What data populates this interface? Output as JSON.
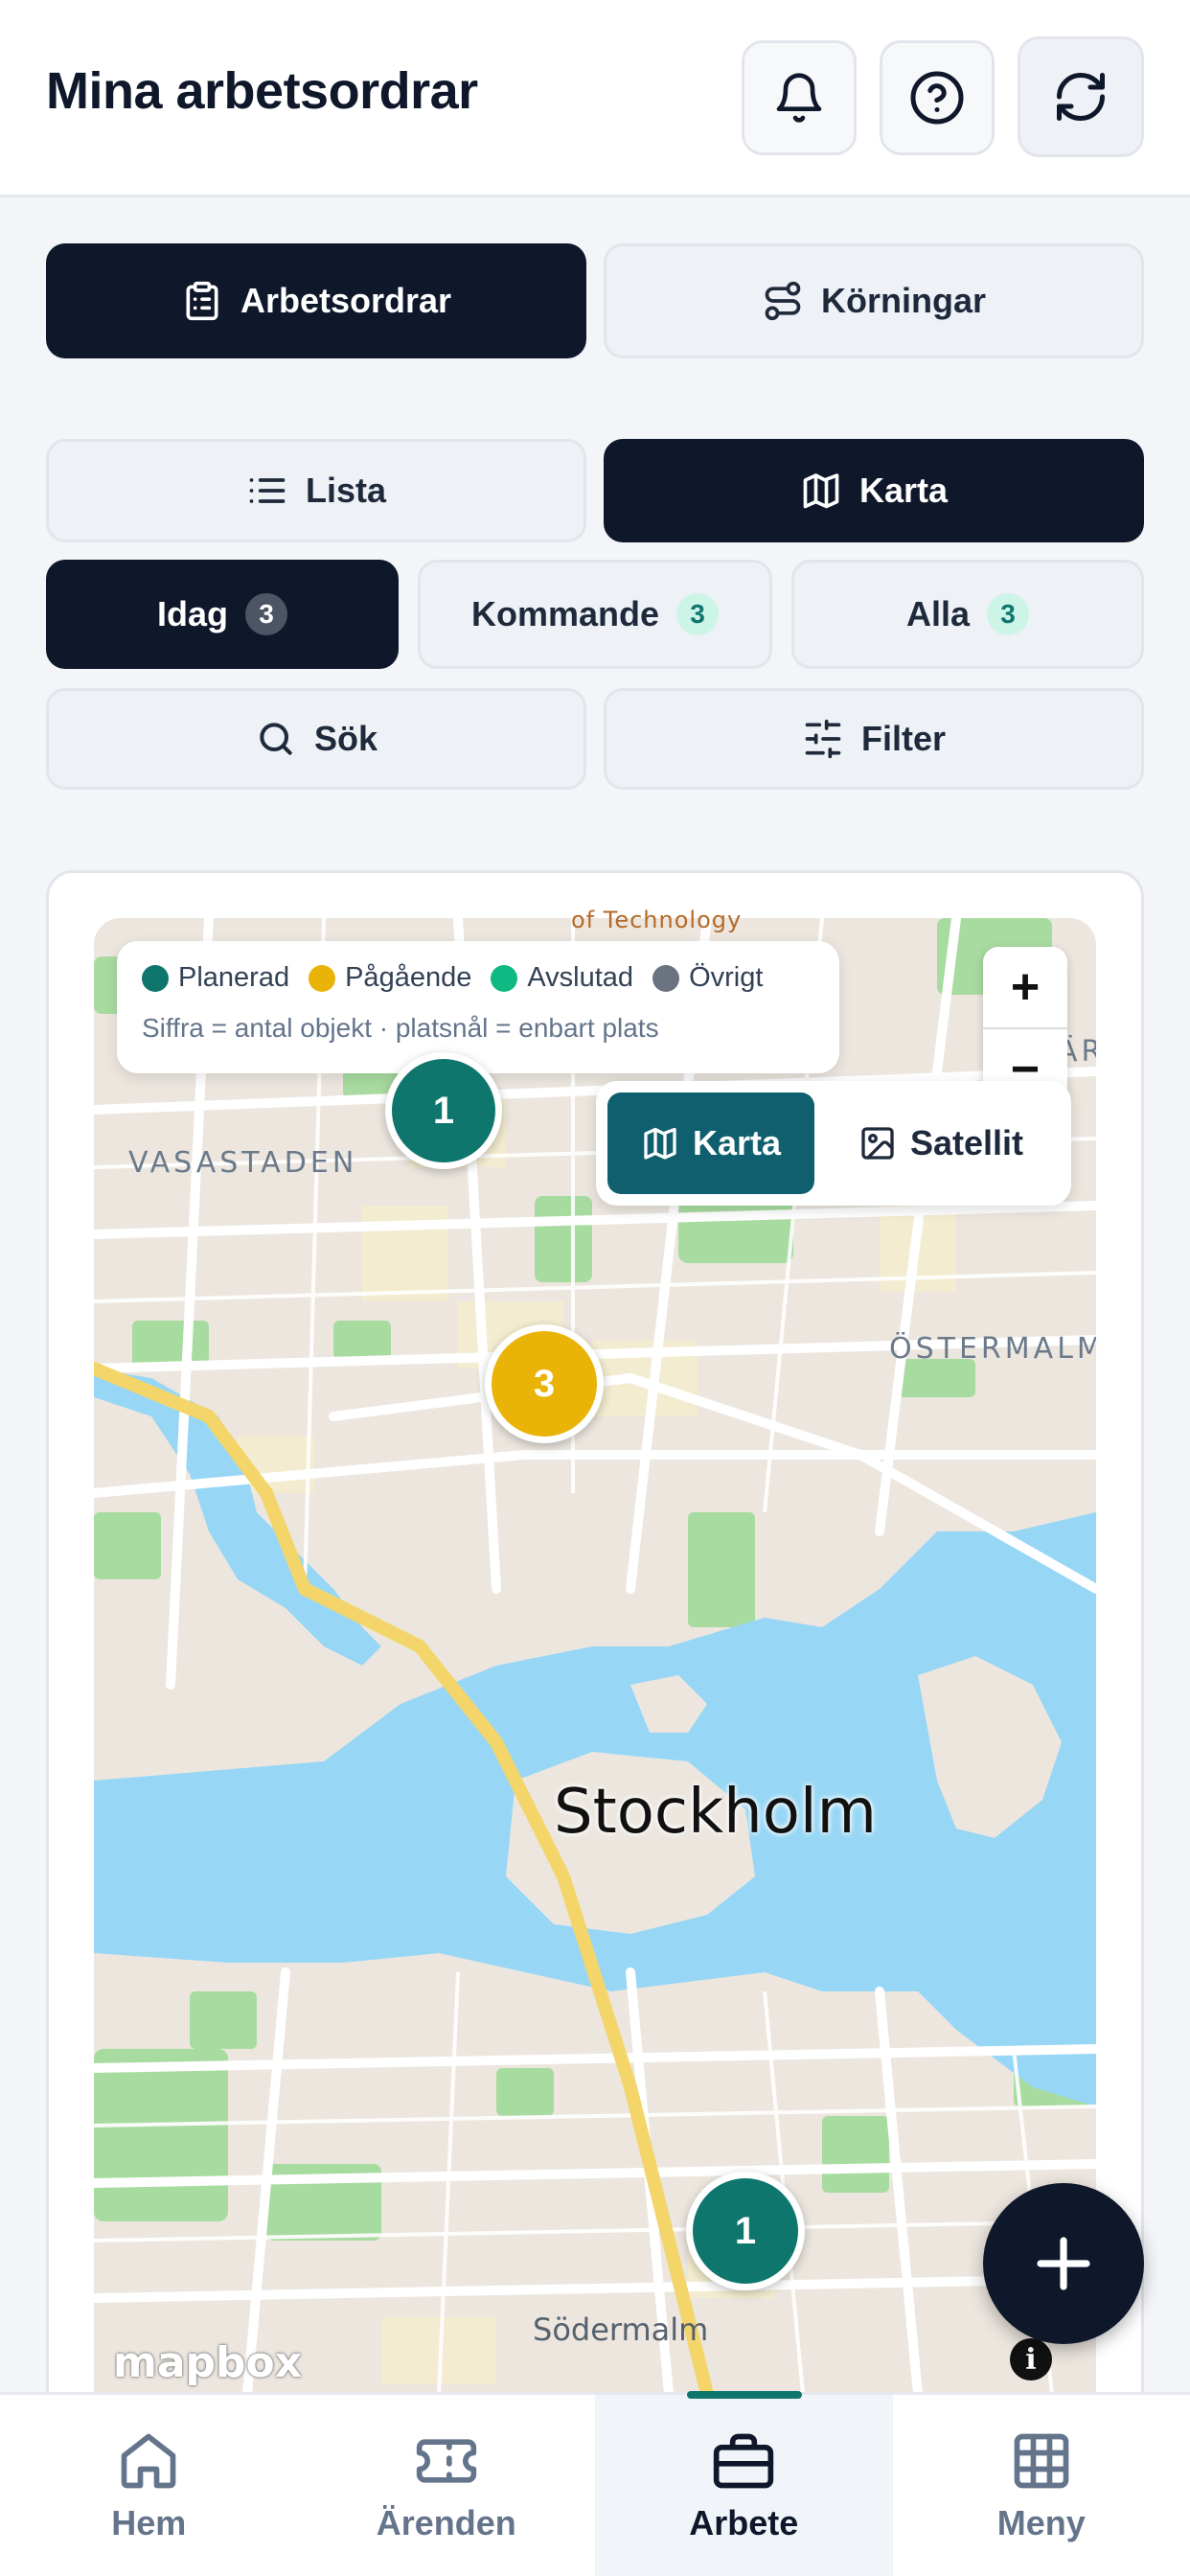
{
  "header": {
    "title": "Mina arbetsordrar",
    "buttons": [
      "bell-icon",
      "help-icon",
      "refresh-icon"
    ]
  },
  "main_tabs": [
    {
      "label": "Arbetsordrar",
      "icon": "clipboard-icon",
      "active": true
    },
    {
      "label": "Körningar",
      "icon": "route-icon",
      "active": false
    }
  ],
  "view_toggle": [
    {
      "label": "Lista",
      "icon": "list-icon",
      "active": false
    },
    {
      "label": "Karta",
      "icon": "map-icon",
      "active": true
    }
  ],
  "date_filters": [
    {
      "label": "Idag",
      "count": "3",
      "active": true
    },
    {
      "label": "Kommande",
      "count": "3",
      "active": false
    },
    {
      "label": "Alla",
      "count": "3",
      "active": false
    }
  ],
  "search": {
    "label": "Sök"
  },
  "filter": {
    "label": "Filter"
  },
  "legend": {
    "items": [
      {
        "label": "Planerad",
        "color": "#0f766e"
      },
      {
        "label": "Pågående",
        "color": "#eab308"
      },
      {
        "label": "Avslutad",
        "color": "#10b981"
      },
      {
        "label": "Övrigt",
        "color": "#6b7280"
      }
    ],
    "note": "Siffra = antal objekt · platsnål = enbart plats"
  },
  "map": {
    "zoom_in": "+",
    "zoom_out": "−",
    "type_options": [
      {
        "label": "Karta",
        "icon": "map-icon",
        "active": true
      },
      {
        "label": "Satellit",
        "icon": "image-icon",
        "active": false
      }
    ],
    "labels": {
      "city": "Stockholm",
      "vasastaden": "VASASTADEN",
      "ostermalm": "ÖSTERMALM",
      "sodermalm": "Södermalm",
      "top_partial": "of Technology",
      "right_partial": "ÄR"
    },
    "markers": [
      {
        "count": "1",
        "status": "Planerad",
        "color": "#0f766e"
      },
      {
        "count": "3",
        "status": "Pågående",
        "color": "#eab308"
      },
      {
        "count": "1",
        "status": "Planerad",
        "color": "#0f766e"
      }
    ],
    "attribution": "mapbox",
    "info": "i"
  },
  "fab": {
    "icon": "plus-icon"
  },
  "bottom_nav": [
    {
      "label": "Hem",
      "icon": "home-icon",
      "active": false
    },
    {
      "label": "Ärenden",
      "icon": "ticket-icon",
      "active": false
    },
    {
      "label": "Arbete",
      "icon": "briefcase-icon",
      "active": true
    },
    {
      "label": "Meny",
      "icon": "grid-icon",
      "active": false
    }
  ]
}
